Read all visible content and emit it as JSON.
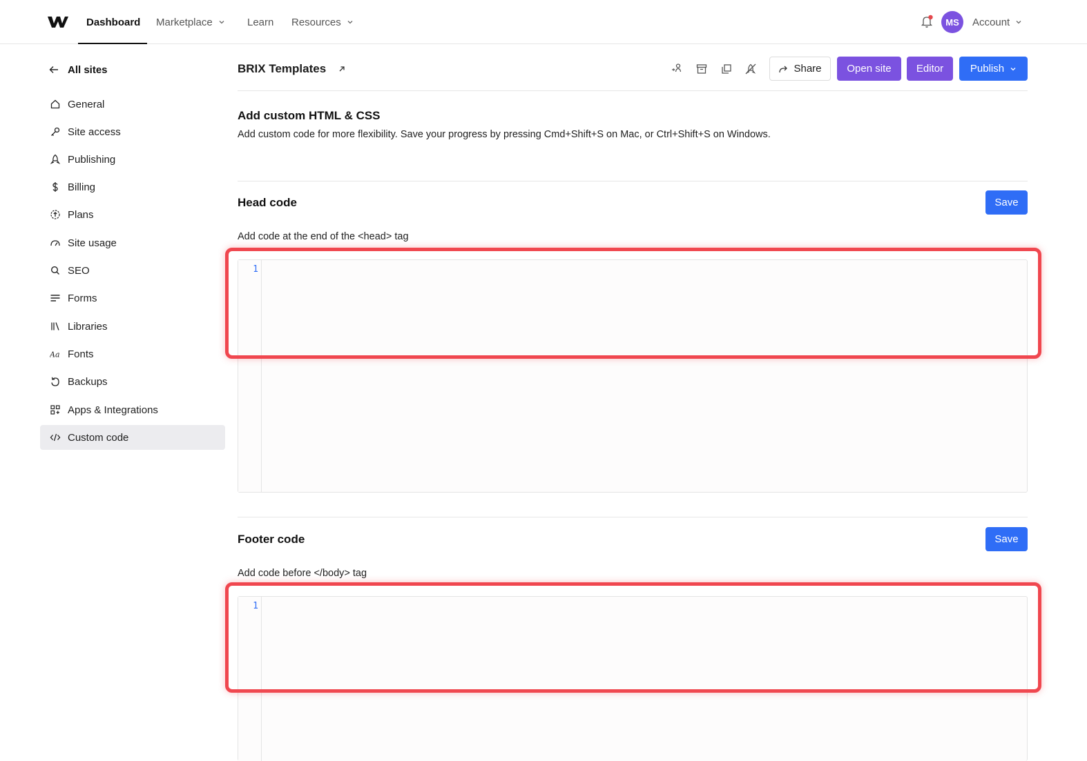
{
  "topnav": {
    "items": [
      {
        "label": "Dashboard",
        "active": true
      },
      {
        "label": "Marketplace",
        "dropdown": true
      },
      {
        "label": "Learn"
      },
      {
        "label": "Resources",
        "dropdown": true
      }
    ],
    "avatar_initials": "MS",
    "account_label": "Account",
    "notification_dot_color": "#e5484d"
  },
  "sidebar": {
    "back_label": "All sites",
    "items": [
      {
        "label": "General",
        "icon": "home-icon"
      },
      {
        "label": "Site access",
        "icon": "key-icon"
      },
      {
        "label": "Publishing",
        "icon": "rocket-icon"
      },
      {
        "label": "Billing",
        "icon": "dollar-icon"
      },
      {
        "label": "Plans",
        "icon": "plans-icon"
      },
      {
        "label": "Site usage",
        "icon": "gauge-icon"
      },
      {
        "label": "SEO",
        "icon": "search-icon"
      },
      {
        "label": "Forms",
        "icon": "forms-icon"
      },
      {
        "label": "Libraries",
        "icon": "libraries-icon"
      },
      {
        "label": "Fonts",
        "icon": "fonts-icon"
      },
      {
        "label": "Backups",
        "icon": "backup-icon"
      },
      {
        "label": "Apps & Integrations",
        "icon": "apps-icon"
      },
      {
        "label": "Custom code",
        "icon": "code-icon",
        "active": true
      }
    ]
  },
  "header": {
    "site_title": "BRIX Templates",
    "share_label": "Share",
    "open_site_label": "Open site",
    "editor_label": "Editor",
    "publish_label": "Publish"
  },
  "intro": {
    "title": "Add custom HTML & CSS",
    "description": "Add custom code for more flexibility. Save your progress by pressing Cmd+Shift+S on Mac, or Ctrl+Shift+S on Windows."
  },
  "head_code": {
    "title": "Head code",
    "save_label": "Save",
    "field_label": "Add code at the end of the <head> tag",
    "line_number": "1",
    "value": ""
  },
  "footer_code": {
    "title": "Footer code",
    "save_label": "Save",
    "field_label": "Add code before </body> tag",
    "line_number": "1",
    "value": ""
  },
  "colors": {
    "purple": "#7b52e0",
    "blue": "#2f6df6",
    "highlight_red": "#f0474f"
  }
}
